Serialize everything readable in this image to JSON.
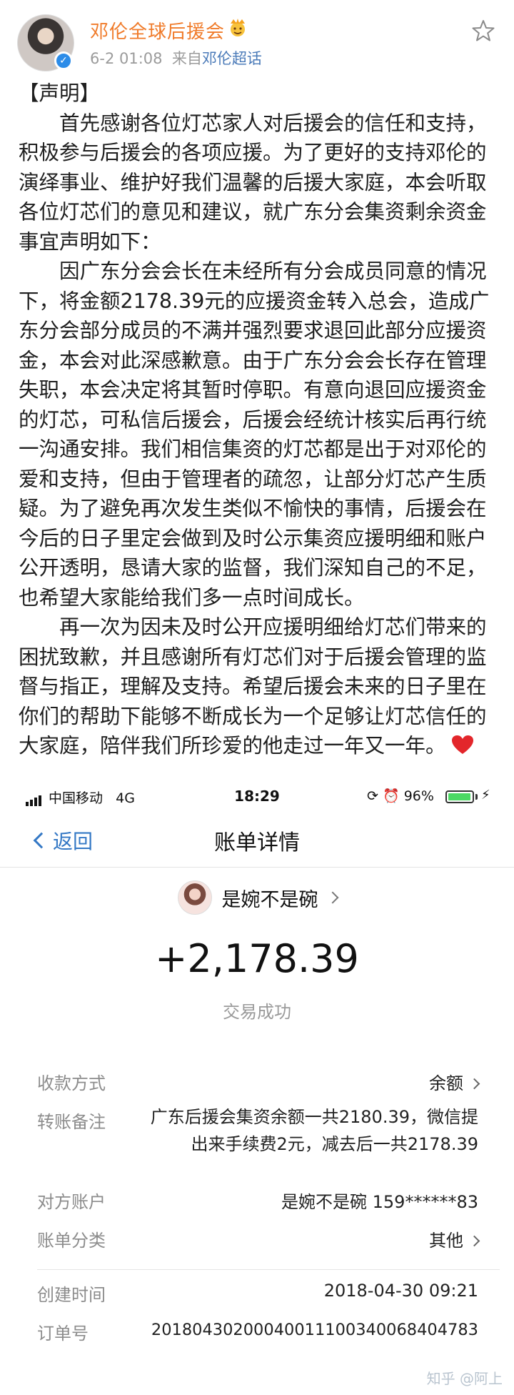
{
  "post": {
    "author": "邓伦全球后援会",
    "author_emoji": "crown-face-emoji",
    "date": "6-2 01:08",
    "source_prefix": "来自",
    "source": "邓伦超话",
    "heading": "【声明】",
    "paragraphs": [
      "首先感谢各位灯芯家人对后援会的信任和支持，积极参与后援会的各项应援。为了更好的支持邓伦的演绎事业、维护好我们温馨的后援大家庭，本会听取各位灯芯们的意见和建议，就广东分会集资剩余资金事宜声明如下：",
      "因广东分会会长在未经所有分会成员同意的情况下，将金额2178.39元的应援资金转入总会，造成广东分会部分成员的不满并强烈要求退回此部分应援资金，本会对此深感歉意。由于广东分会会长存在管理失职，本会决定将其暂时停职。有意向退回应援资金的灯芯，可私信后援会，后援会经统计核实后再行统一沟通安排。我们相信集资的灯芯都是出于对邓伦的爱和支持，但由于管理者的疏忽，让部分灯芯产生质疑。为了避免再次发生类似不愉快的事情，后援会在今后的日子里定会做到及时公示集资应援明细和账户公开透明，恳请大家的监督，我们深知自己的不足，也希望大家能给我们多一点时间成长。",
      "再一次为因未及时公开应援明细给灯芯们带来的困扰致歉，并且感谢所有灯芯们对于后援会管理的监督与指正，理解及支持。希望后援会未来的日子里在你们的帮助下能够不断成长为一个足够让灯芯信任的大家庭，陪伴我们所珍爱的他走过一年又一年。"
    ],
    "end_icon": "red-heart-icon"
  },
  "status_bar": {
    "carrier": "中国移动",
    "network": "4G",
    "time": "18:29",
    "battery": "96%",
    "battery_level": 0.96
  },
  "nav": {
    "back": "返回",
    "title": "账单详情"
  },
  "bill": {
    "payer": "是婉不是碗",
    "amount": "+2,178.39",
    "status": "交易成功",
    "rows": [
      {
        "label": "收款方式",
        "value": "余额"
      },
      {
        "label": "转账备注",
        "value": "广东后援会集资余额一共2180.39，微信提出来手续费2元，减去后一共2178.39"
      },
      {
        "label": "对方账户",
        "value": "是婉不是碗 159******83"
      },
      {
        "label": "账单分类",
        "value": "其他"
      },
      {
        "label": "创建时间",
        "value": "2018-04-30 09:21"
      },
      {
        "label": "订单号",
        "value": "20180430200040011100340068404783"
      }
    ]
  },
  "watermark": "知乎 @阿上",
  "colors": {
    "author": "#f07b2a",
    "link": "#4a7ab8",
    "back": "#3478c5",
    "battery": "#4cd964"
  }
}
